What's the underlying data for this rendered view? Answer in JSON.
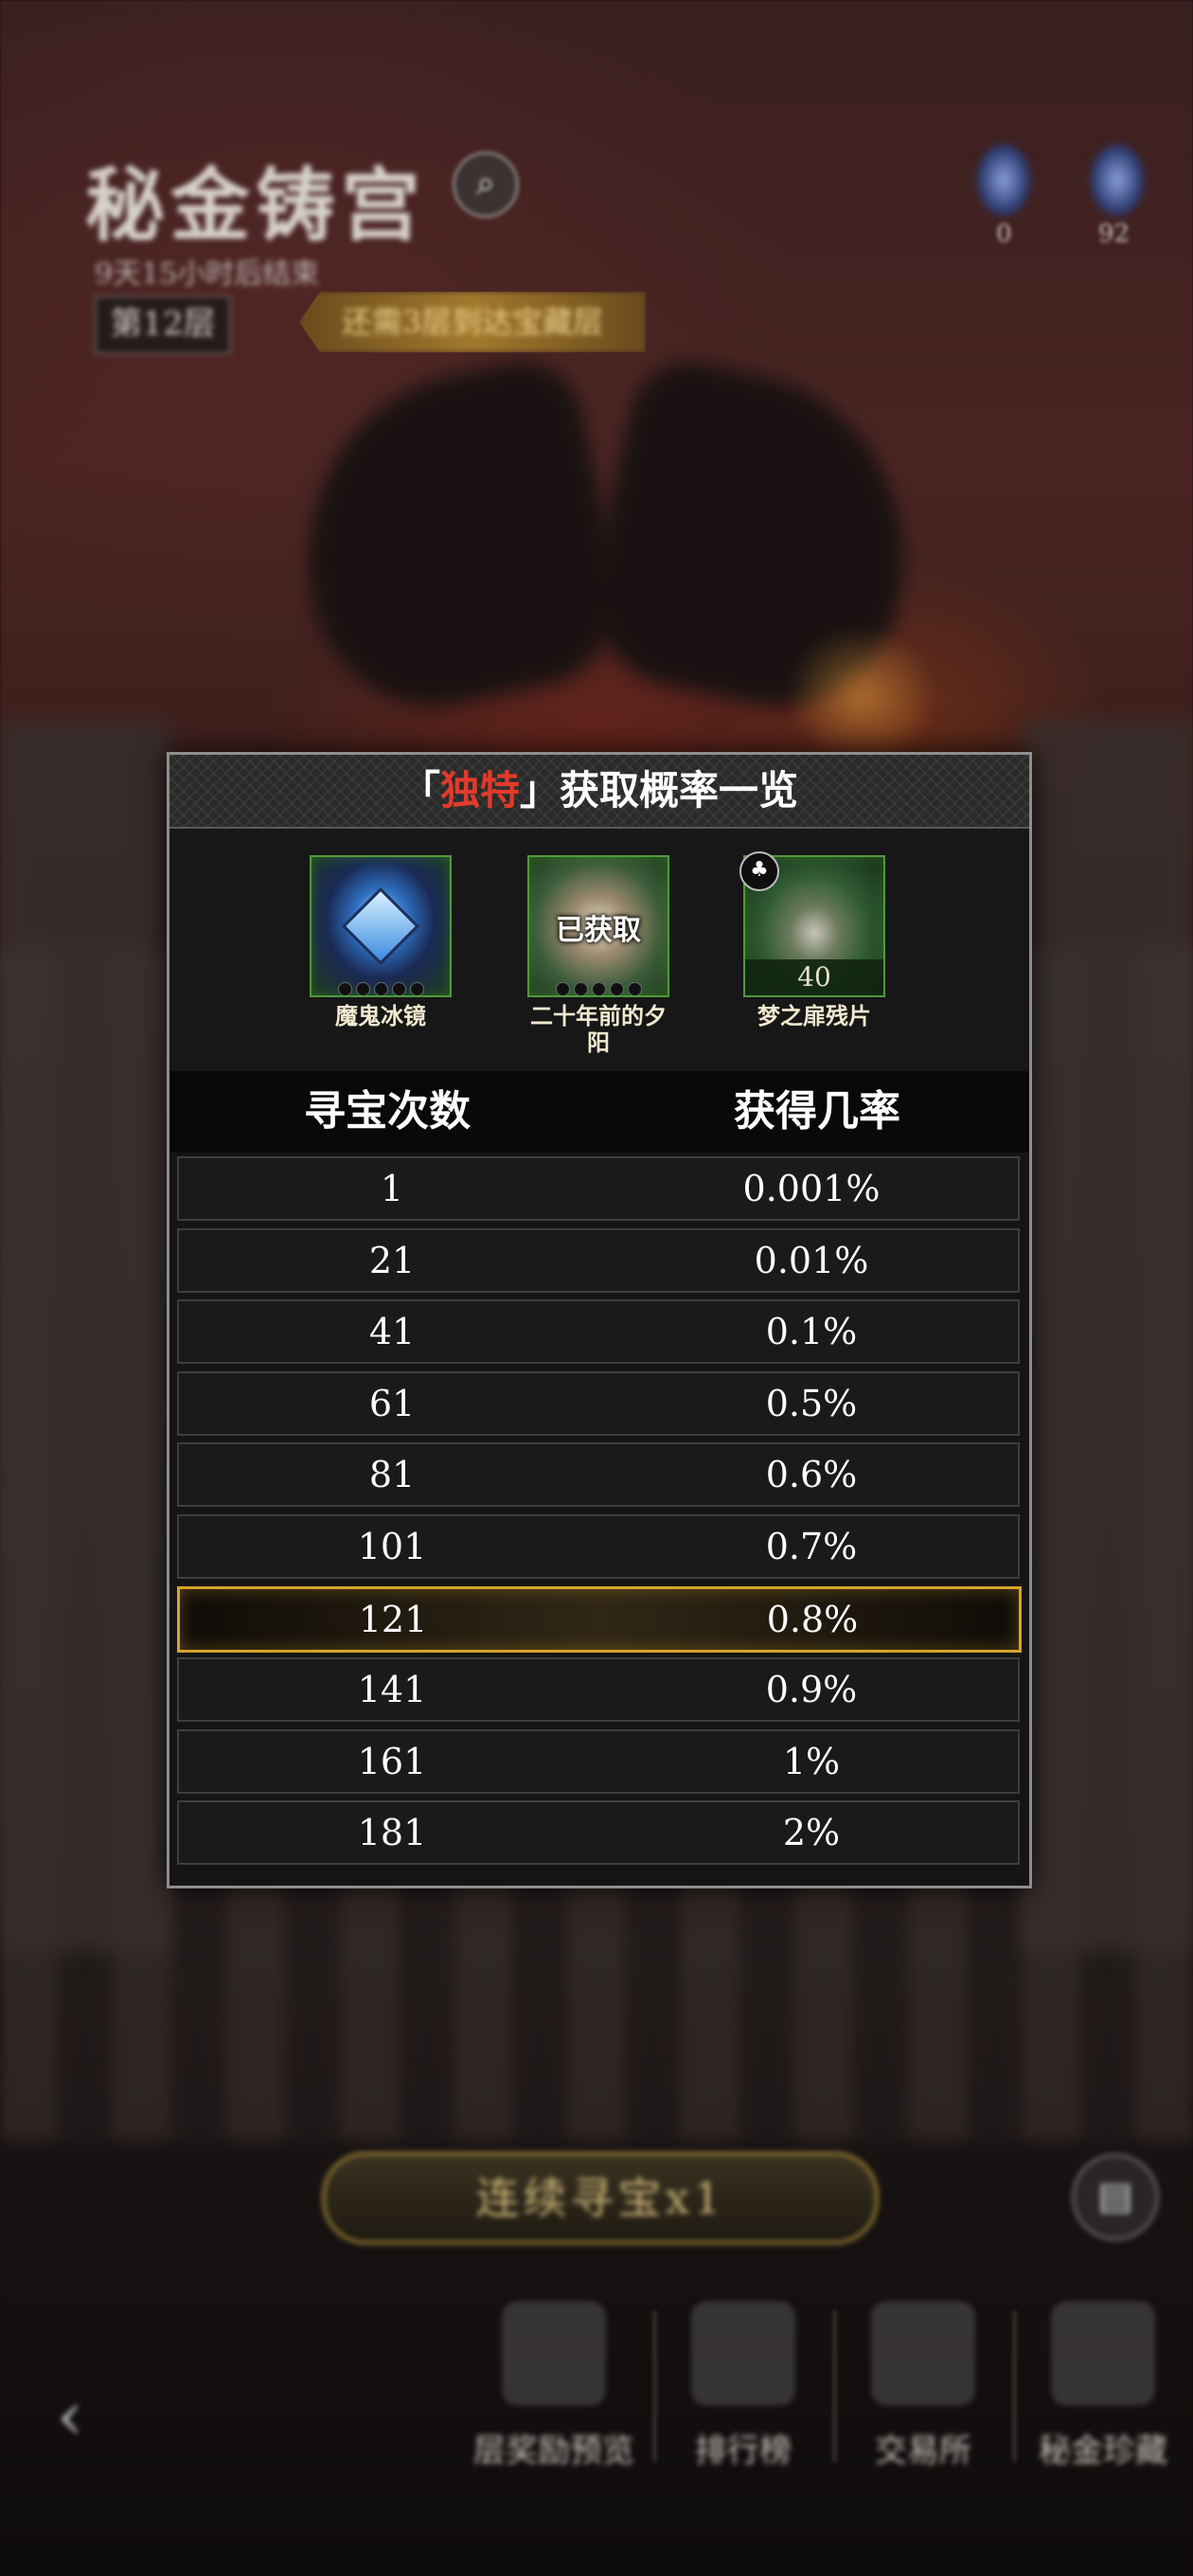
{
  "hud": {
    "title": "秘金铸宫",
    "subtitle": "9天15小时后结束",
    "floor": "第12层",
    "banner": "还需3层到达宝藏层",
    "res1_count": "0",
    "res2_count": "92"
  },
  "modal": {
    "title_bracket_open": "「",
    "title_highlight": "独特",
    "title_bracket_close": "」",
    "title_rest": "获取概率一览",
    "items": [
      {
        "name": "魔鬼冰镜",
        "icon": "ice-mirror-icon"
      },
      {
        "name": "二十年前的夕阳",
        "status": "已获取",
        "icon": "sunset-icon"
      },
      {
        "name": "梦之扉残片",
        "count": "40",
        "icon": "dream-gate-fragment-icon"
      }
    ],
    "header_col1": "寻宝次数",
    "header_col2": "获得几率",
    "rows": [
      {
        "count": "1",
        "rate": "0.001%"
      },
      {
        "count": "21",
        "rate": "0.01%"
      },
      {
        "count": "41",
        "rate": "0.1%"
      },
      {
        "count": "61",
        "rate": "0.5%"
      },
      {
        "count": "81",
        "rate": "0.6%"
      },
      {
        "count": "101",
        "rate": "0.7%"
      },
      {
        "count": "121",
        "rate": "0.8%"
      },
      {
        "count": "141",
        "rate": "0.9%"
      },
      {
        "count": "161",
        "rate": "1%"
      },
      {
        "count": "181",
        "rate": "2%"
      }
    ],
    "highlighted_row_count": "121",
    "accent_color": "#d6a42a",
    "title_highlight_color": "#e23a2a"
  },
  "bottom": {
    "continue_button": "连续寻宝x1",
    "nav": [
      "层奖励预览",
      "排行榜",
      "交易所",
      "秘金珍藏"
    ]
  }
}
